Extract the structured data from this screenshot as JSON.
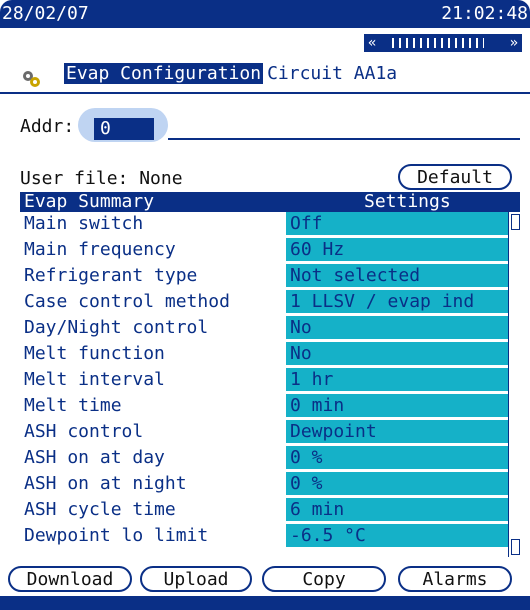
{
  "status_bar": {
    "date": "28/02/07",
    "time": "21:02:48"
  },
  "scroller": {
    "left": "«",
    "right": "»"
  },
  "screen": {
    "title_highlighted": "Evap Configuration",
    "title_rest": "Circuit AA1a",
    "icon": "gear-icon"
  },
  "address": {
    "label": "Addr:",
    "value": "0"
  },
  "user_file": {
    "label": "User file: None",
    "default_button": "Default"
  },
  "table": {
    "header_left": "Evap Summary",
    "header_right": "Settings",
    "rows": [
      {
        "name": "Main switch",
        "value": "Off"
      },
      {
        "name": "Main frequency",
        "value": "60 Hz"
      },
      {
        "name": "Refrigerant type",
        "value": "Not selected"
      },
      {
        "name": "Case control method",
        "value": "1 LLSV / evap ind"
      },
      {
        "name": "Day/Night control",
        "value": "No"
      },
      {
        "name": "Melt function",
        "value": "No"
      },
      {
        "name": "Melt interval",
        "value": "1 hr"
      },
      {
        "name": "Melt time",
        "value": "0 min"
      },
      {
        "name": "ASH control",
        "value": "Dewpoint"
      },
      {
        "name": "ASH on at day",
        "value": "0 %"
      },
      {
        "name": "ASH on at night",
        "value": "0 %"
      },
      {
        "name": "ASH cycle time",
        "value": "6 min"
      },
      {
        "name": "Dewpoint lo limit",
        "value": "-6.5 °C"
      }
    ]
  },
  "buttons": {
    "download": "Download",
    "upload": "Upload",
    "copy": "Copy",
    "alarms": "Alarms"
  },
  "colors": {
    "primary": "#0a2f86",
    "cell": "#15b1c8",
    "highlight": "#bfd4f2"
  }
}
